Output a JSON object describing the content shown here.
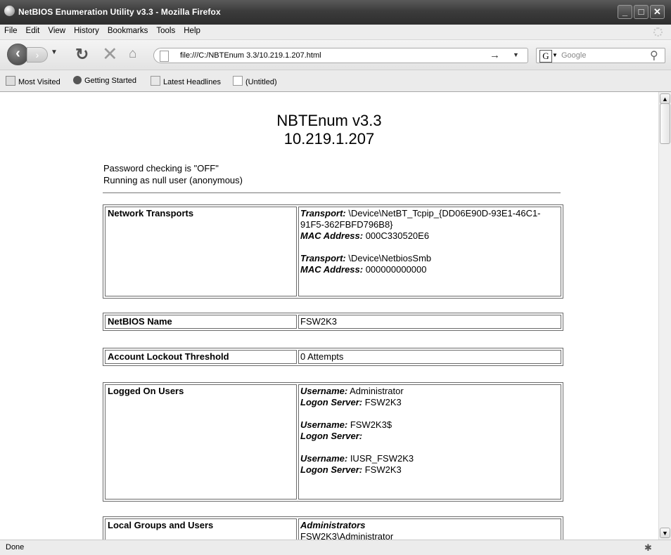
{
  "window": {
    "title": "NetBIOS Enumeration Utility v3.3 - Mozilla Firefox"
  },
  "menu": [
    "File",
    "Edit",
    "View",
    "History",
    "Bookmarks",
    "Tools",
    "Help"
  ],
  "nav": {
    "url": "file:///C:/NBTEnum 3.3/10.219.1.207.html",
    "search_engine": "Google"
  },
  "bookmarks": [
    "Most Visited",
    "Getting Started",
    "Latest Headlines",
    "(Untitled)"
  ],
  "page": {
    "heading": "NBTEnum v3.3",
    "host": "10.219.1.207",
    "notes": [
      "Password checking is \"OFF\"",
      "Running as null user (anonymous)"
    ],
    "transports": {
      "key": "Network Transports",
      "items": [
        {
          "t_label": "Transport:",
          "t_value": " \\Device\\NetBT_Tcpip_{DD06E90D-93E1-46C1-91F5-362FBFD796B8}",
          "m_label": "MAC Address:",
          "m_value": " 000C330520E6"
        },
        {
          "t_label": "Transport:",
          "t_value": " \\Device\\NetbiosSmb",
          "m_label": "MAC Address:",
          "m_value": " 000000000000"
        }
      ]
    },
    "netbios": {
      "key": "NetBIOS Name",
      "value": "FSW2K3"
    },
    "lockout": {
      "key": "Account Lockout Threshold",
      "value": "0 Attempts"
    },
    "logged_on": {
      "key": "Logged On Users",
      "users": [
        {
          "u_label": "Username:",
          "u_value": " Administrator",
          "s_label": "Logon Server:",
          "s_value": " FSW2K3"
        },
        {
          "u_label": "Username:",
          "u_value": " FSW2K3$",
          "s_label": "Logon Server:",
          "s_value": ""
        },
        {
          "u_label": "Username:",
          "u_value": " IUSR_FSW2K3",
          "s_label": "Logon Server:",
          "s_value": " FSW2K3"
        }
      ]
    },
    "groups": {
      "key": "Local Groups and Users",
      "first_group": "Administrators",
      "first_member": "FSW2K3\\Administrator"
    }
  },
  "status": {
    "text": "Done"
  }
}
